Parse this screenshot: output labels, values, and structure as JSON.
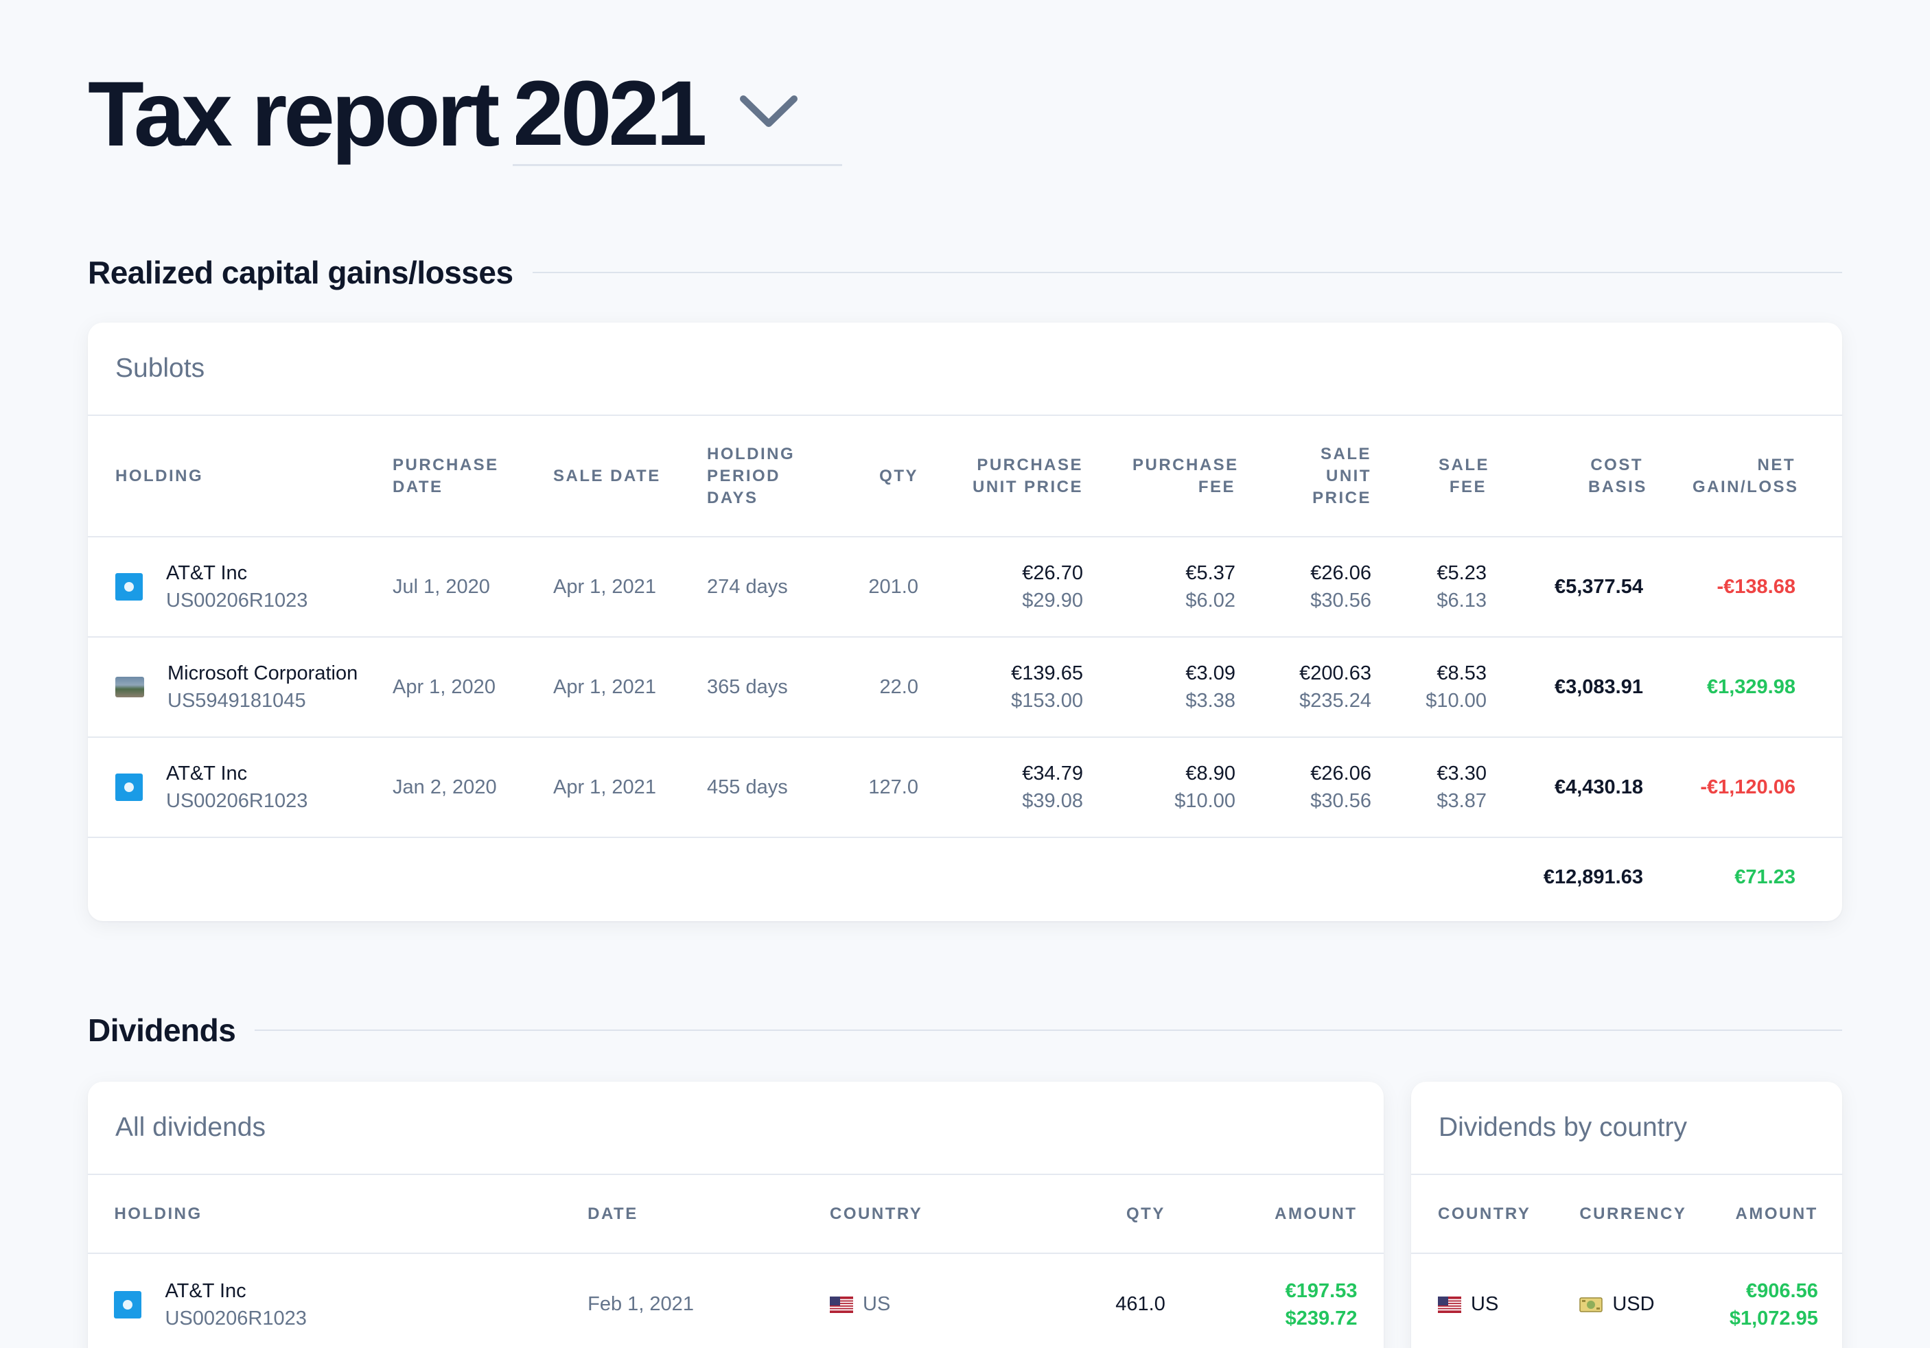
{
  "header": {
    "title": "Tax report",
    "year": "2021",
    "chevron_icon": "chevron-down-icon"
  },
  "capital_gains": {
    "heading": "Realized capital gains/losses",
    "card_title": "Sublots",
    "columns": {
      "holding": "HOLDING",
      "purchase_date": "PURCHASE DATE",
      "sale_date": "SALE DATE",
      "holding_period": "HOLDING PERIOD DAYS",
      "qty": "QTY",
      "purchase_unit_price": "PURCHASE UNIT PRICE",
      "purchase_fee": "PURCHASE FEE",
      "sale_unit_price": "SALE UNIT PRICE",
      "sale_fee": "SALE FEE",
      "cost_basis": "COST BASIS",
      "net_gain_loss": "NET GAIN/LOSS"
    },
    "rows": [
      {
        "name": "AT&T Inc",
        "isin": "US00206R1023",
        "logo": "att-logo",
        "purchase_date": "Jul 1, 2020",
        "sale_date": "Apr 1, 2021",
        "holding_period": "274 days",
        "qty": "201.0",
        "purchase_unit_price_eur": "€26.70",
        "purchase_unit_price_usd": "$29.90",
        "purchase_fee_eur": "€5.37",
        "purchase_fee_usd": "$6.02",
        "sale_unit_price_eur": "€26.06",
        "sale_unit_price_usd": "$30.56",
        "sale_fee_eur": "€5.23",
        "sale_fee_usd": "$6.13",
        "cost_basis": "€5,377.54",
        "net": "-€138.68",
        "net_sign": "negative"
      },
      {
        "name": "Microsoft Corporation",
        "isin": "US5949181045",
        "logo": "microsoft-logo",
        "purchase_date": "Apr 1, 2020",
        "sale_date": "Apr 1, 2021",
        "holding_period": "365 days",
        "qty": "22.0",
        "purchase_unit_price_eur": "€139.65",
        "purchase_unit_price_usd": "$153.00",
        "purchase_fee_eur": "€3.09",
        "purchase_fee_usd": "$3.38",
        "sale_unit_price_eur": "€200.63",
        "sale_unit_price_usd": "$235.24",
        "sale_fee_eur": "€8.53",
        "sale_fee_usd": "$10.00",
        "cost_basis": "€3,083.91",
        "net": "€1,329.98",
        "net_sign": "positive"
      },
      {
        "name": "AT&T Inc",
        "isin": "US00206R1023",
        "logo": "att-logo",
        "purchase_date": "Jan 2, 2020",
        "sale_date": "Apr 1, 2021",
        "holding_period": "455 days",
        "qty": "127.0",
        "purchase_unit_price_eur": "€34.79",
        "purchase_unit_price_usd": "$39.08",
        "purchase_fee_eur": "€8.90",
        "purchase_fee_usd": "$10.00",
        "sale_unit_price_eur": "€26.06",
        "sale_unit_price_usd": "$30.56",
        "sale_fee_eur": "€3.30",
        "sale_fee_usd": "$3.87",
        "cost_basis": "€4,430.18",
        "net": "-€1,120.06",
        "net_sign": "negative"
      }
    ],
    "totals": {
      "cost_basis": "€12,891.63",
      "net": "€71.23"
    }
  },
  "dividends": {
    "heading": "Dividends",
    "all": {
      "card_title": "All dividends",
      "columns": {
        "holding": "HOLDING",
        "date": "DATE",
        "country": "COUNTRY",
        "qty": "QTY",
        "amount": "AMOUNT"
      },
      "rows": [
        {
          "name": "AT&T Inc",
          "isin": "US00206R1023",
          "logo": "att-logo",
          "date": "Feb 1, 2021",
          "country": "US",
          "flag": "us-flag-icon",
          "qty": "461.0",
          "amount_eur": "€197.53",
          "amount_usd": "$239.72"
        }
      ]
    },
    "by_country": {
      "card_title": "Dividends by country",
      "columns": {
        "country": "COUNTRY",
        "currency": "CURRENCY",
        "amount": "AMOUNT"
      },
      "rows": [
        {
          "country": "US",
          "flag": "us-flag-icon",
          "currency": "USD",
          "currency_icon": "banknote-icon",
          "amount_eur": "€906.56",
          "amount_usd": "$1,072.95"
        }
      ]
    }
  },
  "colors": {
    "background": "#f7f9fc",
    "positive": "#22c55e",
    "negative": "#ef4444",
    "muted": "#64748b",
    "att_blue": "#1a9be6"
  }
}
